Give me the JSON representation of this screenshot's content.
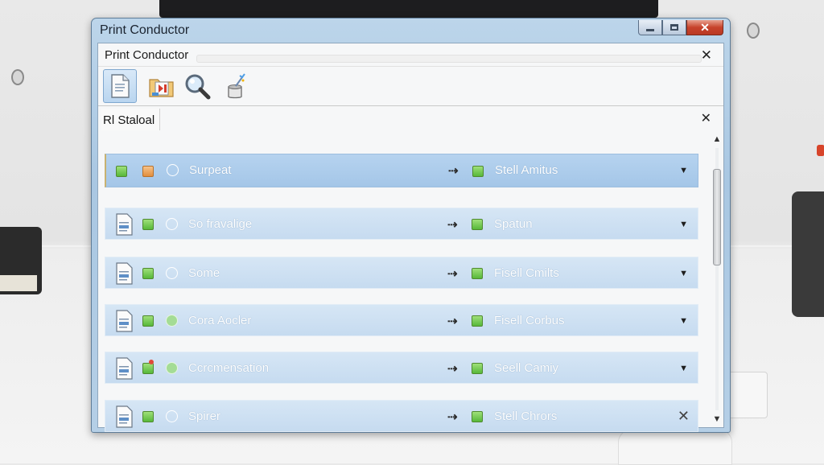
{
  "window": {
    "title": "Print Conductor",
    "controls": {
      "minimize": "minimize",
      "maximize": "maximize",
      "close": "✕"
    }
  },
  "inner": {
    "title": "Print Conductor",
    "close": "✕"
  },
  "toolbar": {
    "buttons": [
      {
        "icon": "document-icon",
        "active": true
      },
      {
        "icon": "folder-add-icon",
        "active": false
      },
      {
        "icon": "magnifier-icon",
        "active": false
      },
      {
        "icon": "cleaner-icon",
        "active": false
      }
    ]
  },
  "section": {
    "title": "Rl Staloal",
    "close": "✕"
  },
  "rows": [
    {
      "name": "Surpeat",
      "right": "Stell Amitus",
      "action": "▼"
    },
    {
      "name": "So fravalige",
      "right": "Spatun",
      "action": "▼"
    },
    {
      "name": "Some",
      "right": "Fisell Cmilts",
      "action": "▼"
    },
    {
      "name": "Cora Aocler",
      "right": "Fisell Corbus",
      "action": "▼"
    },
    {
      "name": "Ccrcmensation",
      "right": "Seell Camiy",
      "action": "▼"
    },
    {
      "name": "Spirer",
      "right": "Stell Chrors",
      "action": "✕"
    }
  ],
  "row_connector": "⇢",
  "scrollbar": {
    "up": "▲",
    "down": "▼"
  },
  "colors": {
    "selected_row": "#a9c9e9",
    "row": "#cfe1f3",
    "window_frame": "#b3cde5",
    "status_green": "#5fbf3f",
    "status_orange": "#e8954a"
  }
}
